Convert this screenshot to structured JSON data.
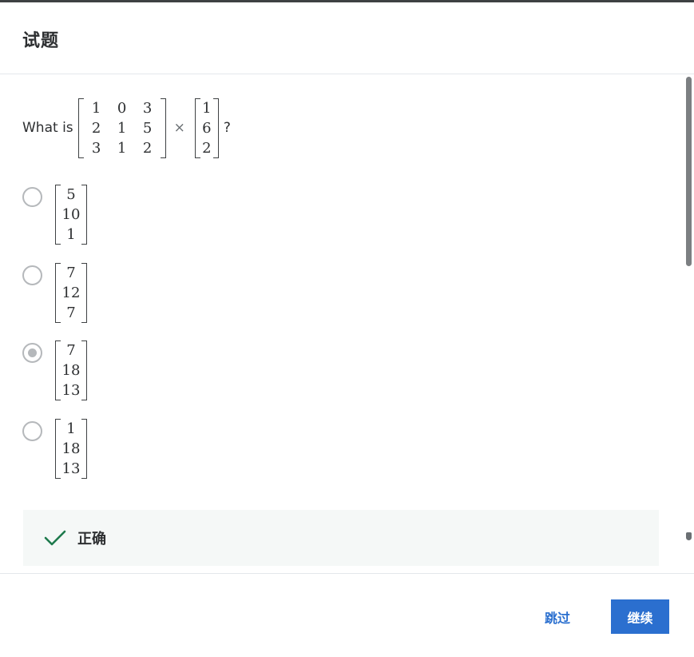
{
  "header": {
    "title": "试题"
  },
  "question": {
    "prefix": "What is",
    "times": "×",
    "suffix": "?",
    "matrix_a": [
      [
        "1",
        "0",
        "3"
      ],
      [
        "2",
        "1",
        "5"
      ],
      [
        "3",
        "1",
        "2"
      ]
    ],
    "vector_b": [
      "1",
      "6",
      "2"
    ]
  },
  "options": [
    {
      "values": [
        "5",
        "10",
        "1"
      ],
      "selected": false
    },
    {
      "values": [
        "7",
        "12",
        "7"
      ],
      "selected": false
    },
    {
      "values": [
        "7",
        "18",
        "13"
      ],
      "selected": true
    },
    {
      "values": [
        "1",
        "18",
        "13"
      ],
      "selected": false
    }
  ],
  "feedback": {
    "label": "正确",
    "icon": "checkmark-icon",
    "color": "#1e7a4c"
  },
  "footer": {
    "skip_label": "跳过",
    "continue_label": "继续"
  },
  "colors": {
    "accent": "#2b6fcf",
    "success": "#1e7a4c"
  }
}
